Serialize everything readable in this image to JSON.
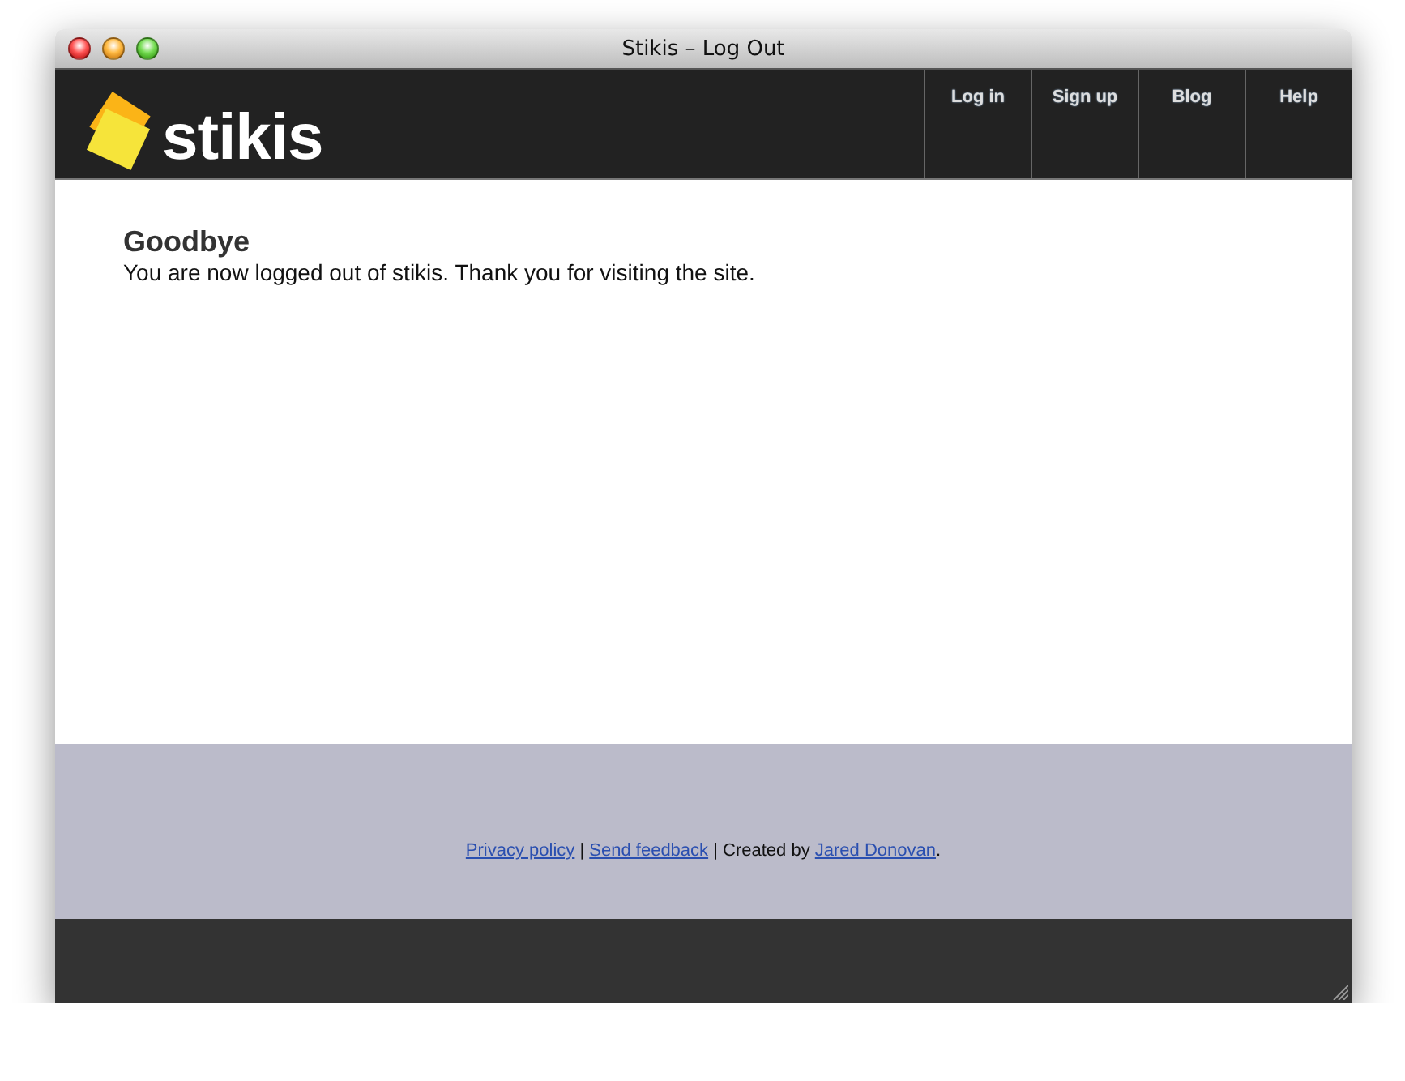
{
  "window": {
    "title": "Stikis – Log Out"
  },
  "header": {
    "logo_text": "stikis",
    "nav": [
      {
        "label": "Log in"
      },
      {
        "label": "Sign up"
      },
      {
        "label": "Blog"
      },
      {
        "label": "Help"
      }
    ]
  },
  "content": {
    "heading": "Goodbye",
    "message": "You are now logged out of stikis. Thank you for visiting the site."
  },
  "footer": {
    "parts": [
      {
        "kind": "link",
        "text": "Privacy policy"
      },
      {
        "kind": "text",
        "text": " | "
      },
      {
        "kind": "link",
        "text": "Send feedback"
      },
      {
        "kind": "text",
        "text": " | Created by "
      },
      {
        "kind": "link",
        "text": "Jared Donovan"
      },
      {
        "kind": "text",
        "text": "."
      }
    ]
  }
}
